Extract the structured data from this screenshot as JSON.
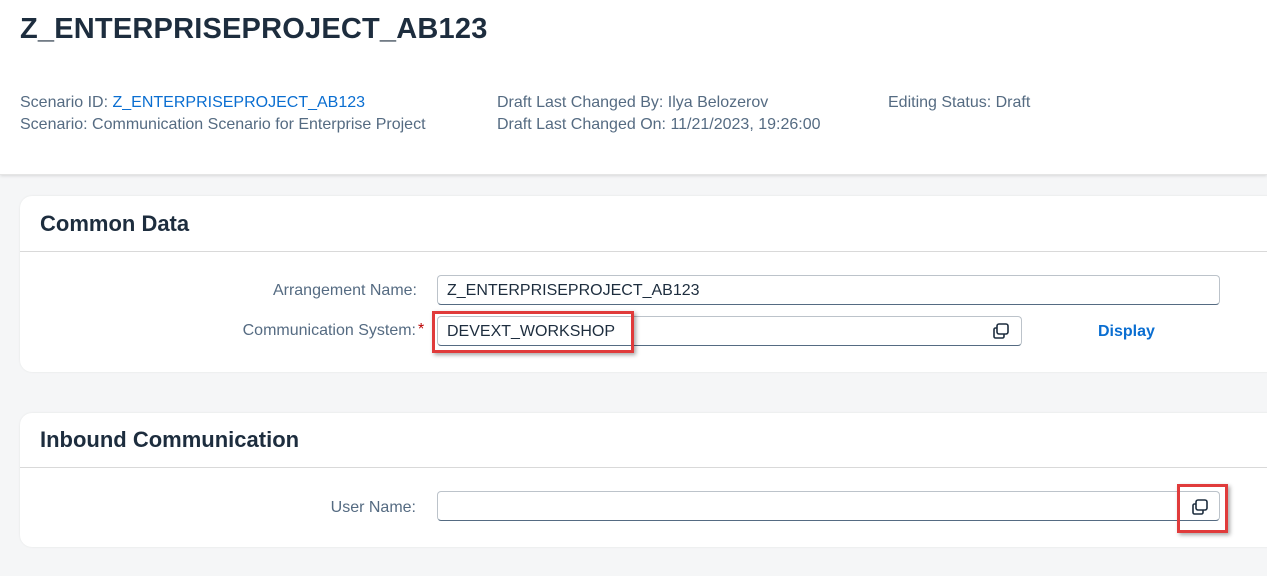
{
  "header": {
    "title": "Z_ENTERPRISEPROJECT_AB123",
    "scenario_id_label": "Scenario ID:",
    "scenario_id_value": "Z_ENTERPRISEPROJECT_AB123",
    "scenario_label": "Scenario:",
    "scenario_value": "Communication Scenario for Enterprise Project",
    "changed_by_label": "Draft Last Changed By:",
    "changed_by_value": "Ilya Belozerov",
    "changed_on_label": "Draft Last Changed On:",
    "changed_on_value": "11/21/2023, 19:26:00",
    "editing_status_label": "Editing Status:",
    "editing_status_value": "Draft"
  },
  "common_data": {
    "title": "Common Data",
    "arrangement_name_label": "Arrangement Name:",
    "arrangement_name_value": "Z_ENTERPRISEPROJECT_AB123",
    "communication_system_label": "Communication System:",
    "required_marker": "*",
    "communication_system_value": "DEVEXT_WORKSHOP",
    "display_link": "Display"
  },
  "inbound": {
    "title": "Inbound Communication",
    "user_name_label": "User Name:",
    "user_name_value": ""
  },
  "icons": {
    "value_help": "value-help-icon"
  },
  "colors": {
    "link": "#0a6ed1",
    "highlight": "#e03b3b",
    "required": "#bb0000"
  }
}
